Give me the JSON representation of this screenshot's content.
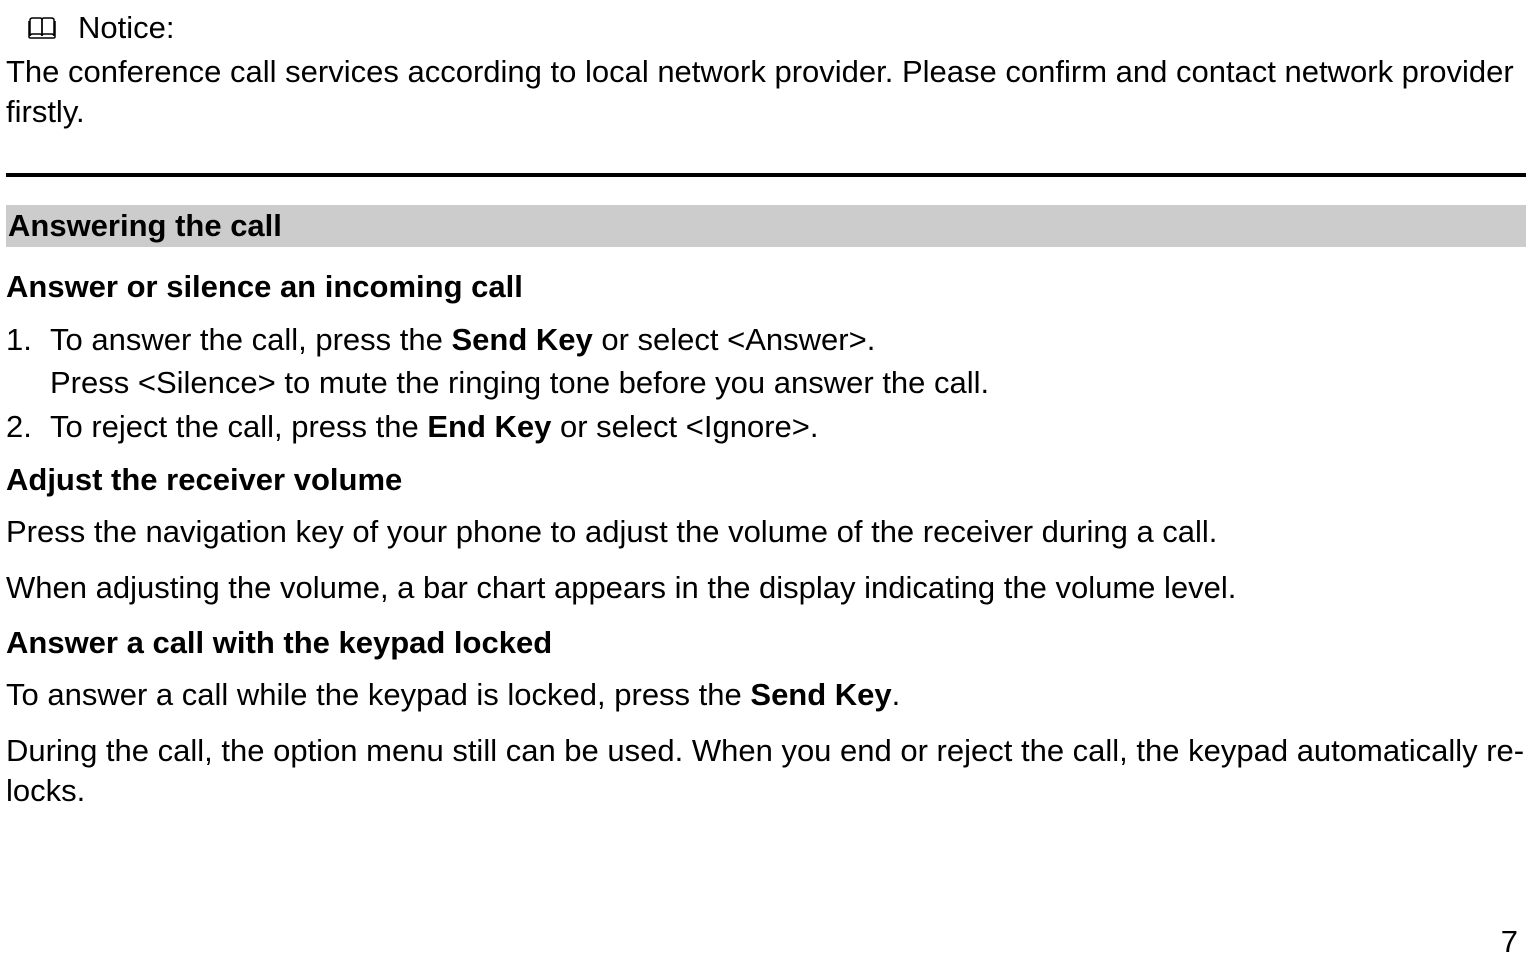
{
  "notice": {
    "label": "Notice:",
    "text": "The conference call services according to local network provider. Please confirm and contact network provider firstly."
  },
  "section": {
    "header": "Answering the call",
    "sub1": {
      "heading": "Answer or silence an incoming call",
      "item1_num": "1.",
      "item1_a": "To answer the call, press the ",
      "item1_b": "Send Key",
      "item1_c": " or select <Answer>.",
      "item1_sub": "Press <Silence> to mute the ringing tone before you answer the call.",
      "item2_num": "2.",
      "item2_a": "To reject the call, press the ",
      "item2_b": "End Key",
      "item2_c": " or select <Ignore>."
    },
    "sub2": {
      "heading": "Adjust the receiver volume",
      "p1": "Press the navigation key of your phone to adjust the volume of the receiver during a call.",
      "p2": "When adjusting the volume, a bar chart appears in the display indicating the volume level."
    },
    "sub3": {
      "heading": "Answer a call with the keypad locked",
      "p1_a": "To answer a call while the keypad is locked, press the ",
      "p1_b": "Send Key",
      "p1_c": ".",
      "p2": "During the call, the option menu still can be used. When you end or reject the call, the keypad automatically re-locks."
    }
  },
  "page_number": "7"
}
